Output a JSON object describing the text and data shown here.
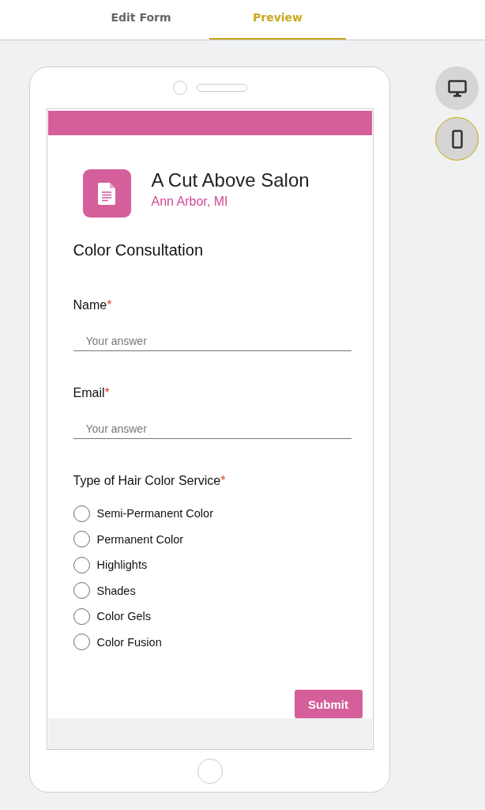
{
  "tabs": [
    {
      "label": "Edit Form",
      "selected": false
    },
    {
      "label": "Preview",
      "selected": true
    }
  ],
  "device_toggles": [
    {
      "kind": "desktop",
      "selected": false
    },
    {
      "kind": "mobile",
      "selected": true
    }
  ],
  "form": {
    "title": "A Cut Above Salon",
    "subtitle": "Ann Arbor, MI",
    "heading": "Color Consultation",
    "questions": [
      {
        "kind": "text",
        "label": "Name",
        "required_mark": "*",
        "placeholder": "Your answer"
      },
      {
        "kind": "text",
        "label": "Email",
        "required_mark": "*",
        "placeholder": "Your answer"
      },
      {
        "kind": "radio",
        "label": "Type of Hair Color Service",
        "required_mark": "*",
        "options": [
          {
            "label": "Semi-Permanent Color",
            "selected": false
          },
          {
            "label": "Permanent Color",
            "selected": false
          },
          {
            "label": "Highlights",
            "selected": false
          },
          {
            "label": "Shades",
            "selected": false
          },
          {
            "label": "Color Gels",
            "selected": false
          },
          {
            "label": "Color Fusion",
            "selected": false
          }
        ]
      }
    ],
    "submit": "Submit"
  }
}
